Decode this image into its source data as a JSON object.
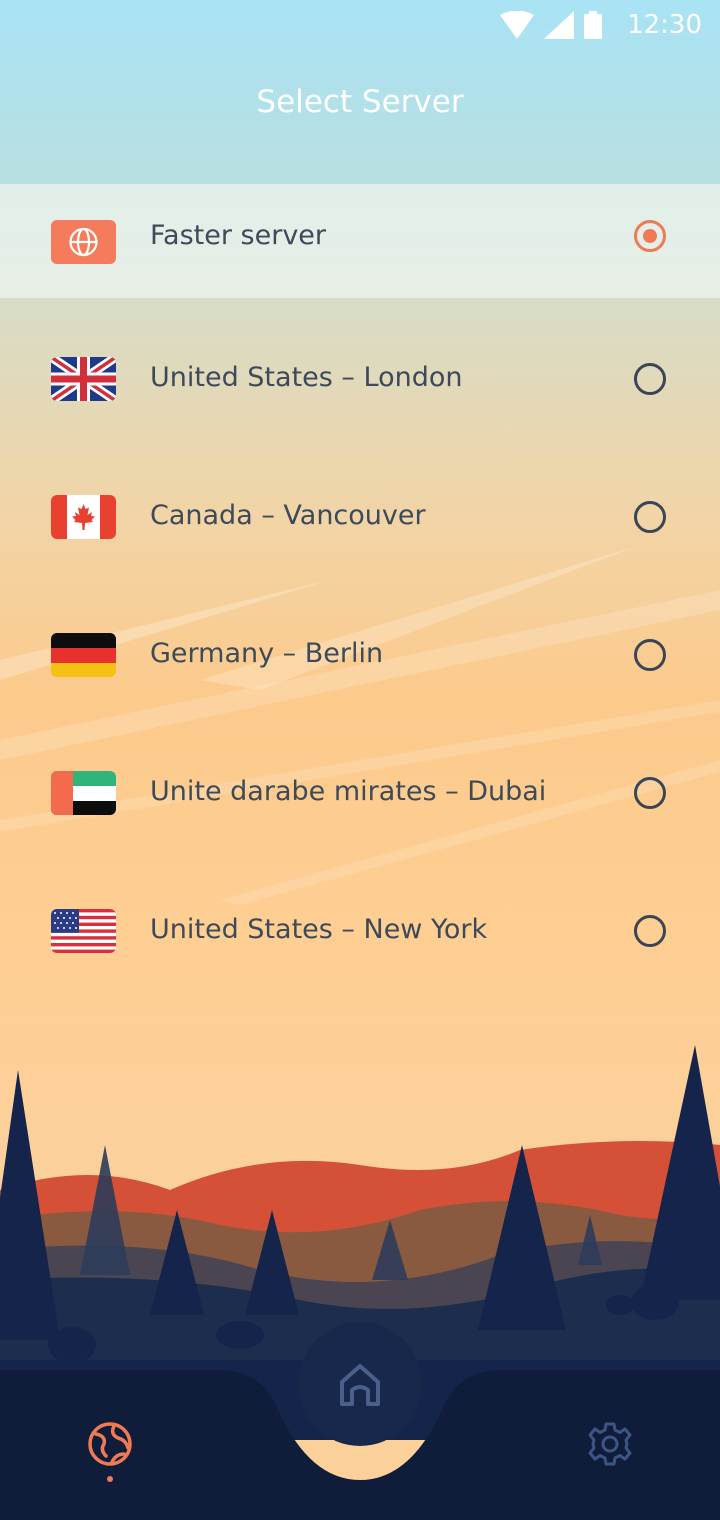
{
  "status_bar": {
    "time": "12:30",
    "icons": [
      "wifi-icon",
      "cellular-signal-icon",
      "battery-icon"
    ]
  },
  "header": {
    "title": "Select Server"
  },
  "servers": [
    {
      "label": "Faster server",
      "flag": "globe",
      "selected": true
    },
    {
      "label": "United States – London",
      "flag": "uk",
      "selected": false
    },
    {
      "label": "Canada – Vancouver",
      "flag": "canada",
      "selected": false
    },
    {
      "label": "Germany – Berlin",
      "flag": "germany",
      "selected": false
    },
    {
      "label": "Unite darabe mirates – Dubai",
      "flag": "uae",
      "selected": false
    },
    {
      "label": "United States – New York",
      "flag": "usa",
      "selected": false
    }
  ],
  "nav": {
    "items": [
      "servers-globe-icon",
      "home-icon",
      "settings-gear-icon"
    ],
    "active": "servers-globe-icon"
  },
  "colors": {
    "accent": "#f07a55",
    "text": "#3c4a5a",
    "nav_bg": "#0f1d3a"
  }
}
